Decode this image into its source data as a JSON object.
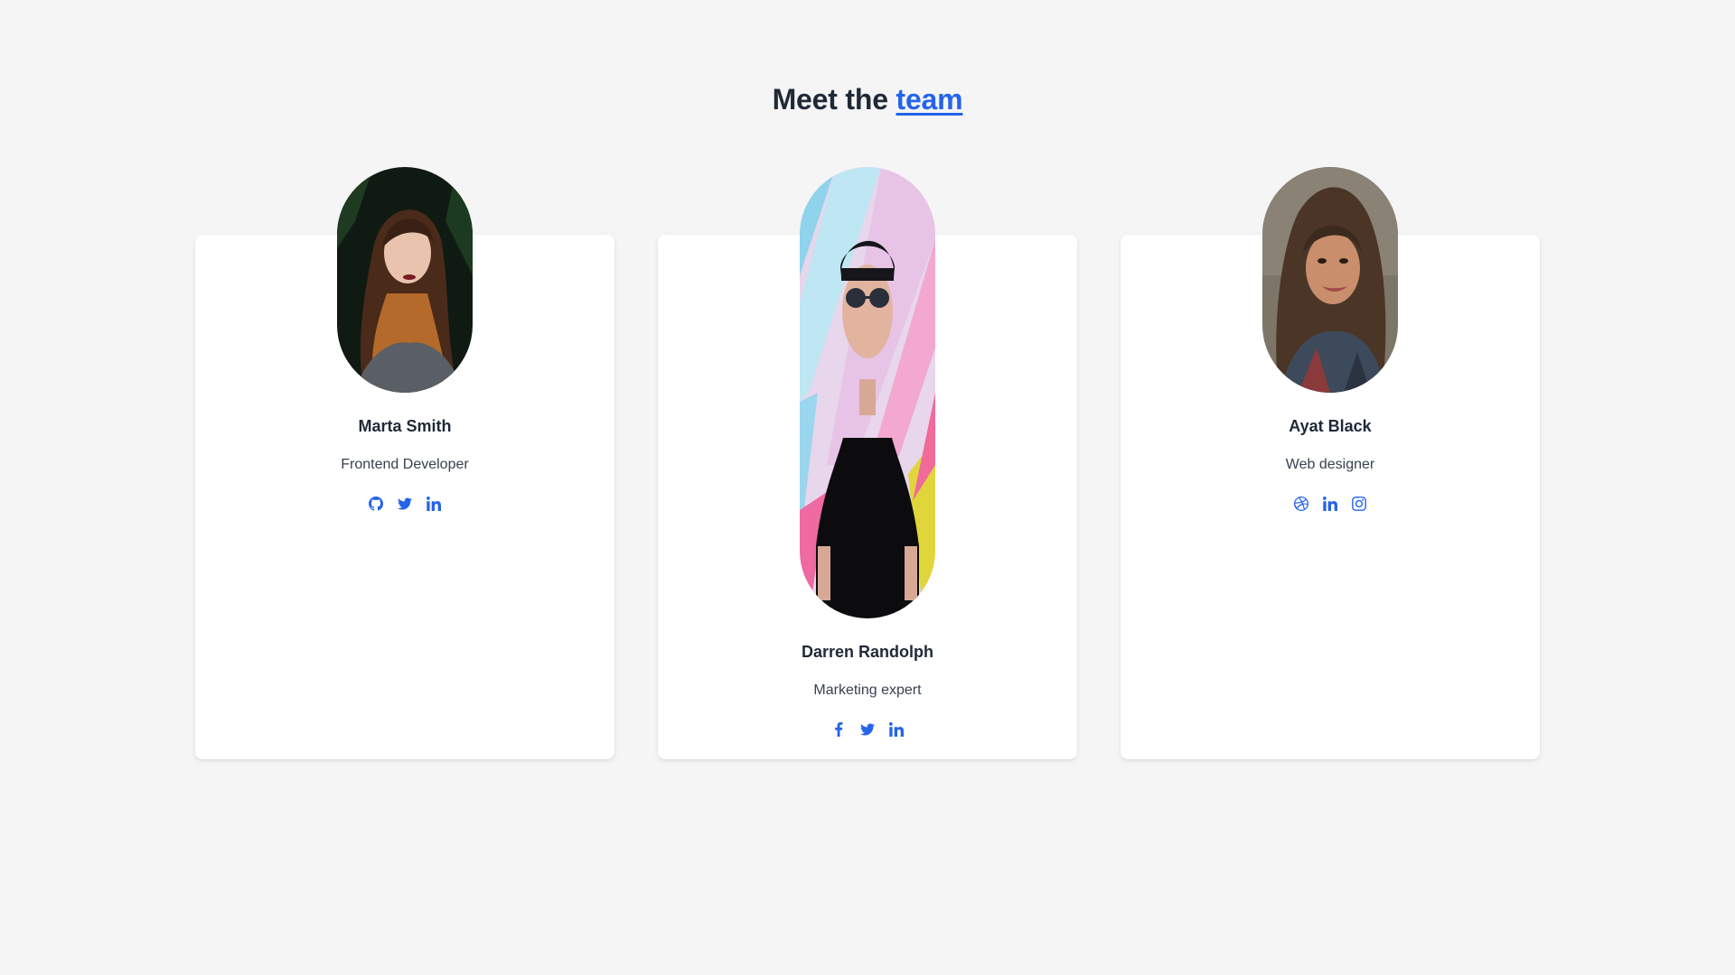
{
  "heading": {
    "prefix": "Meet the",
    "accent": "team"
  },
  "colors": {
    "accent": "#2563eb",
    "background": "#f5f5f5",
    "card": "#ffffff"
  },
  "members": [
    {
      "name": "Marta Smith",
      "role": "Frontend Developer",
      "socials": [
        "github-icon",
        "twitter-icon",
        "linkedin-icon"
      ]
    },
    {
      "name": "Darren Randolph",
      "role": "Marketing expert",
      "socials": [
        "facebook-icon",
        "twitter-icon",
        "linkedin-icon"
      ]
    },
    {
      "name": "Ayat Black",
      "role": "Web designer",
      "socials": [
        "dribbble-icon",
        "linkedin-icon",
        "instagram-icon"
      ]
    }
  ]
}
